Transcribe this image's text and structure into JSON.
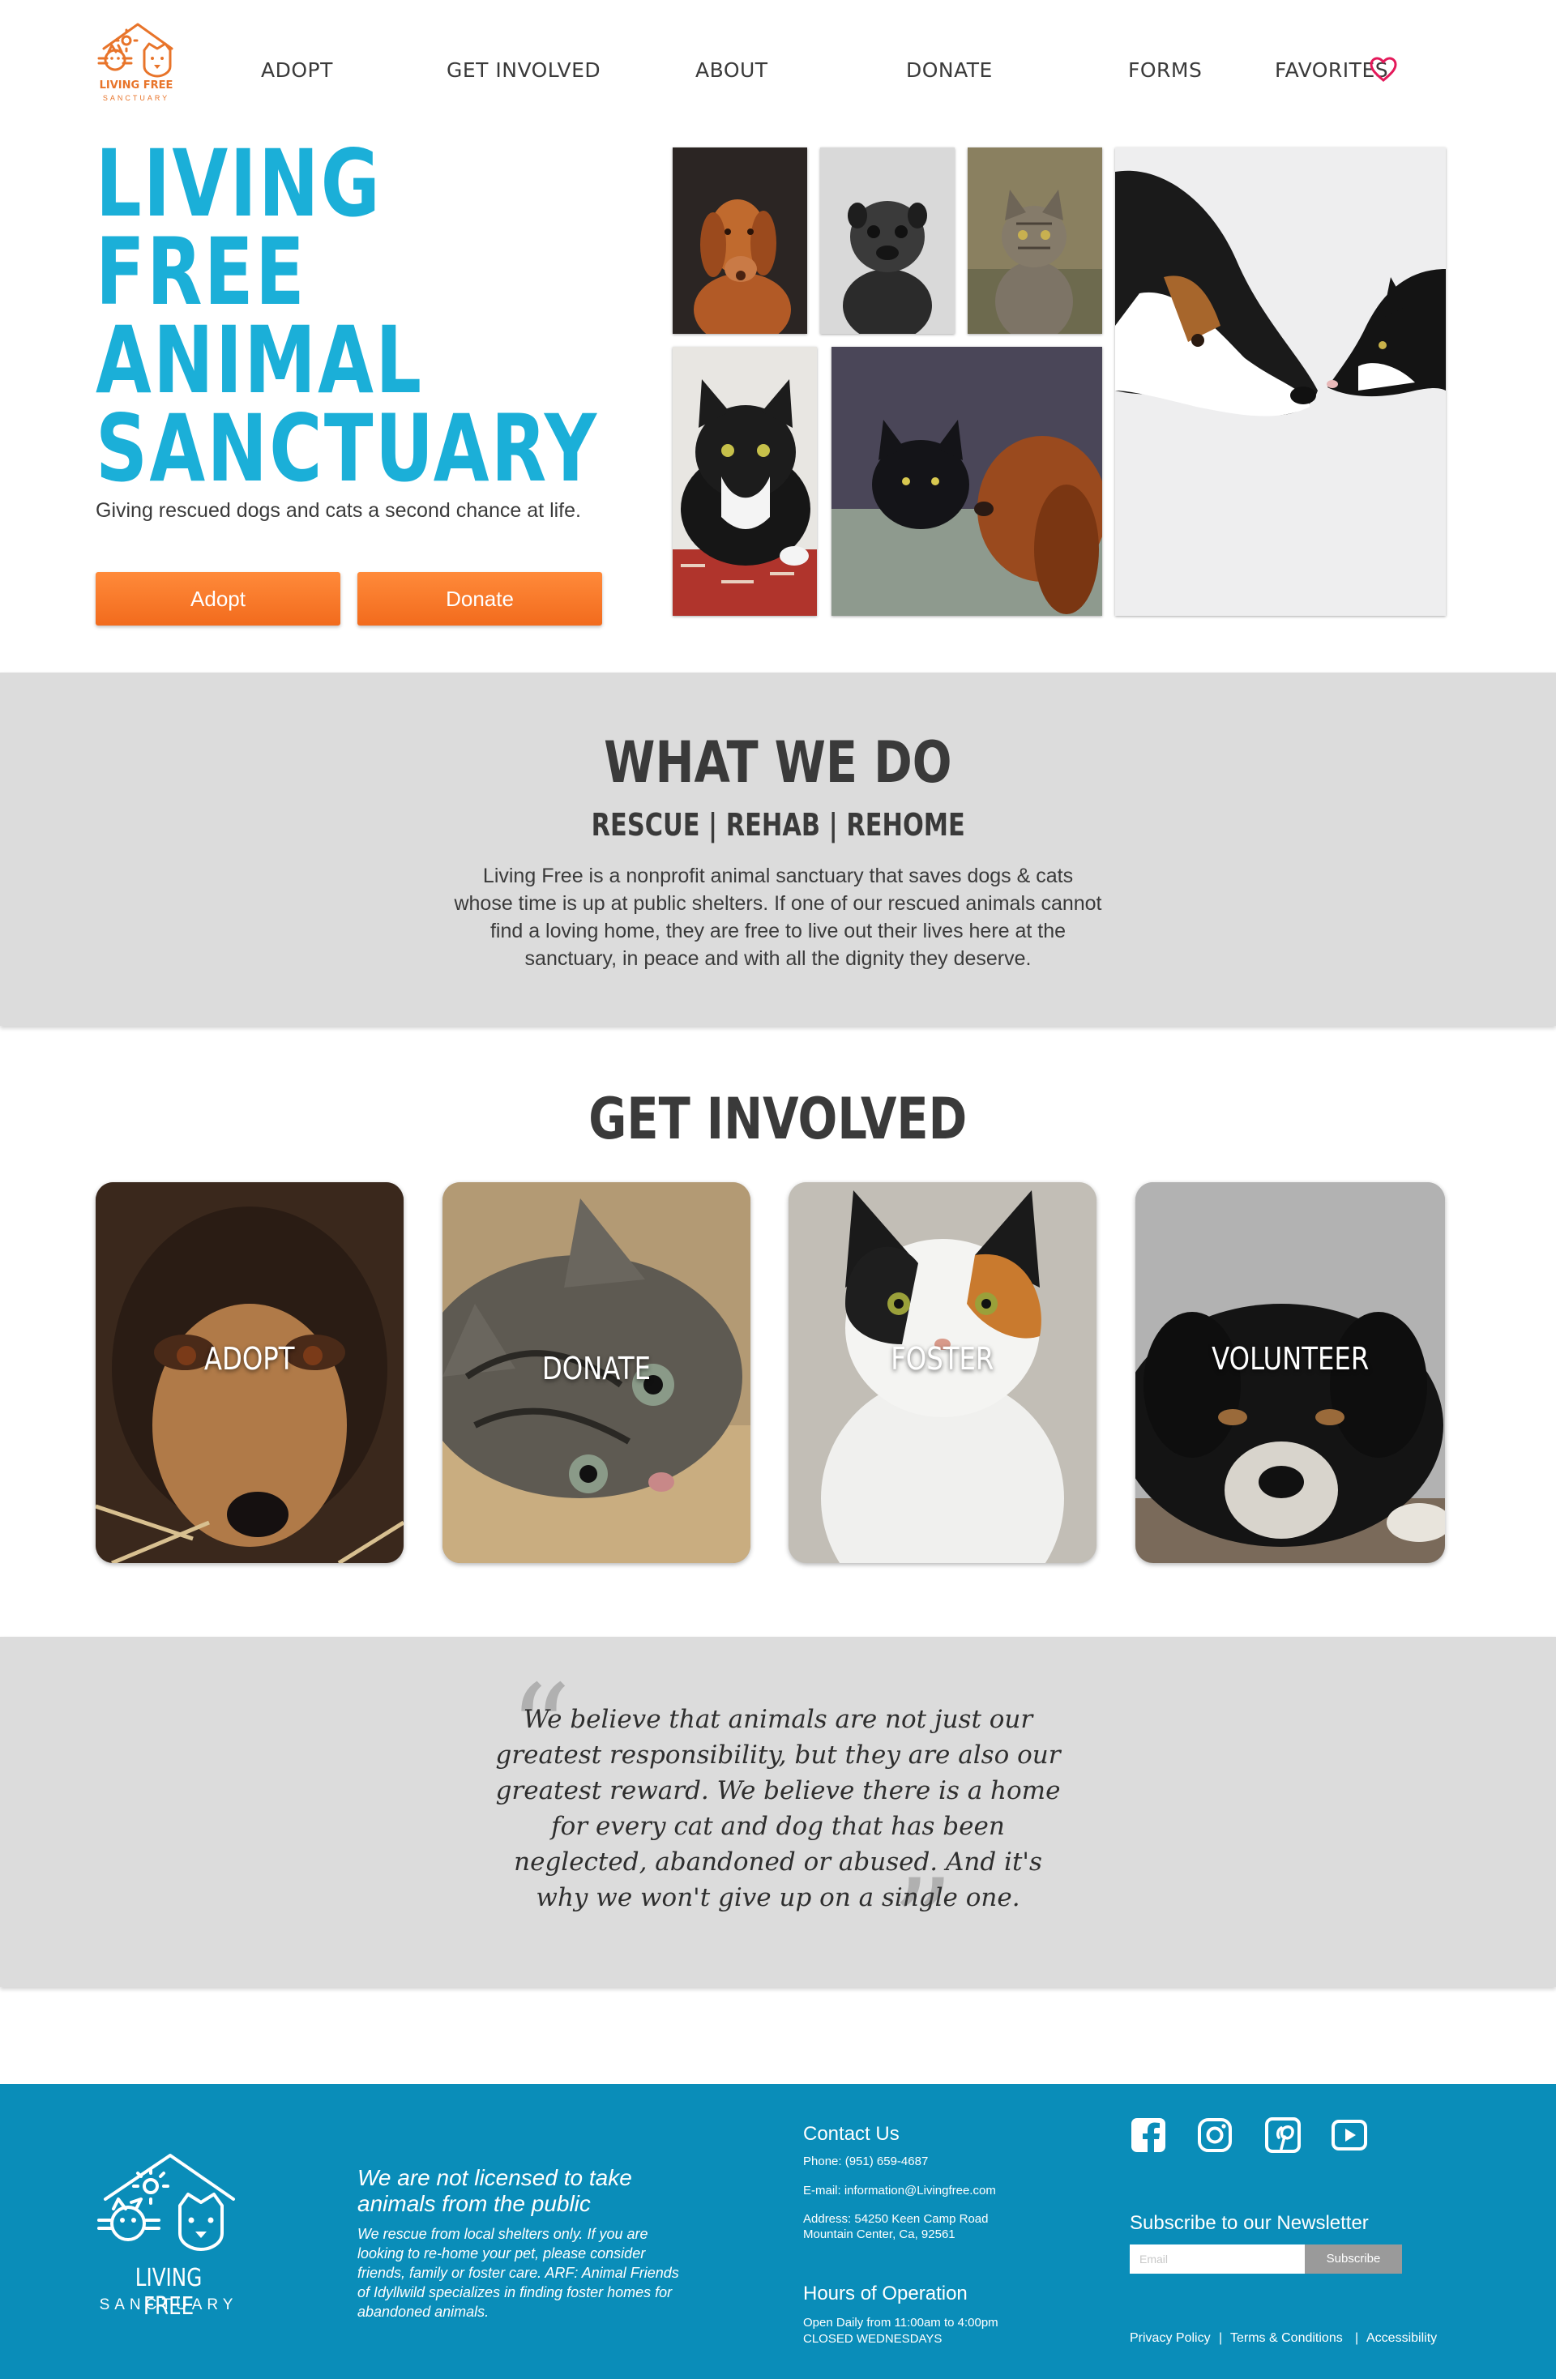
{
  "header": {
    "logo": {
      "line1": "LIVING FREE",
      "line2": "SANCTUARY"
    },
    "nav": [
      "ADOPT",
      "GET INVOLVED",
      "ABOUT",
      "DONATE",
      "FORMS",
      "FAVORITES"
    ],
    "favorites_icon": "heart-icon",
    "heart_color": "#e4195a"
  },
  "hero": {
    "title_lines": [
      "LIVING",
      "FREE",
      "ANIMAL",
      "SANCTUARY"
    ],
    "subtitle": "Giving rescued dogs and cats a second chance at life.",
    "adopt_label": "Adopt",
    "donate_label": "Donate",
    "accent_color": "#1bafd8",
    "button_color": "#f47320"
  },
  "what_we_do": {
    "title": "WHAT WE DO",
    "tagline": "RESCUE | REHAB | REHOME",
    "body": "Living Free is a nonprofit animal sanctuary that saves dogs & cats whose time is up at public shelters. If one of our rescued animals cannot find a loving home, they are free to live out their lives here at the sanctuary, in peace and with all the dignity they deserve."
  },
  "get_involved": {
    "title": "GET INVOLVED",
    "cards": [
      "ADOPT",
      "DONATE",
      "FOSTER",
      "VOLUNTEER"
    ]
  },
  "quote": {
    "text": "We believe that animals are not just our greatest responsibility, but they are also our greatest reward. We believe there is a home for every cat and dog that has been neglected, abandoned or abused. And it's why we won't give up on a single one."
  },
  "footer": {
    "logo": {
      "line1": "LIVING FREE",
      "line2": "SANCTUARY"
    },
    "notice_title": "We are not licensed to take animals from the public",
    "notice_body": "We rescue from local shelters only. If you are looking to re-home your pet, please consider friends, family or foster care. ARF: Animal Friends of Idyllwild specializes in finding foster homes for abandoned animals.",
    "contact_title": "Contact Us",
    "phone": "Phone: (951) 659-4687",
    "email": "E-mail: information@Livingfree.com",
    "address1": "Address: 54250 Keen Camp Road",
    "address2": "Mountain Center, Ca, 92561",
    "hours_title": "Hours of Operation",
    "hours1": "Open Daily from 11:00am to 4:00pm",
    "hours2": "CLOSED WEDNESDAYS",
    "social": [
      "facebook-icon",
      "instagram-icon",
      "pinterest-icon",
      "youtube-icon"
    ],
    "newsletter_title": "Subscribe to our Newsletter",
    "email_placeholder": "Email",
    "subscribe_label": "Subscribe",
    "links": [
      "Privacy Policy",
      "Terms & Conditions",
      "Accessibility"
    ],
    "separator": "|",
    "background_color": "#0a8db9"
  }
}
